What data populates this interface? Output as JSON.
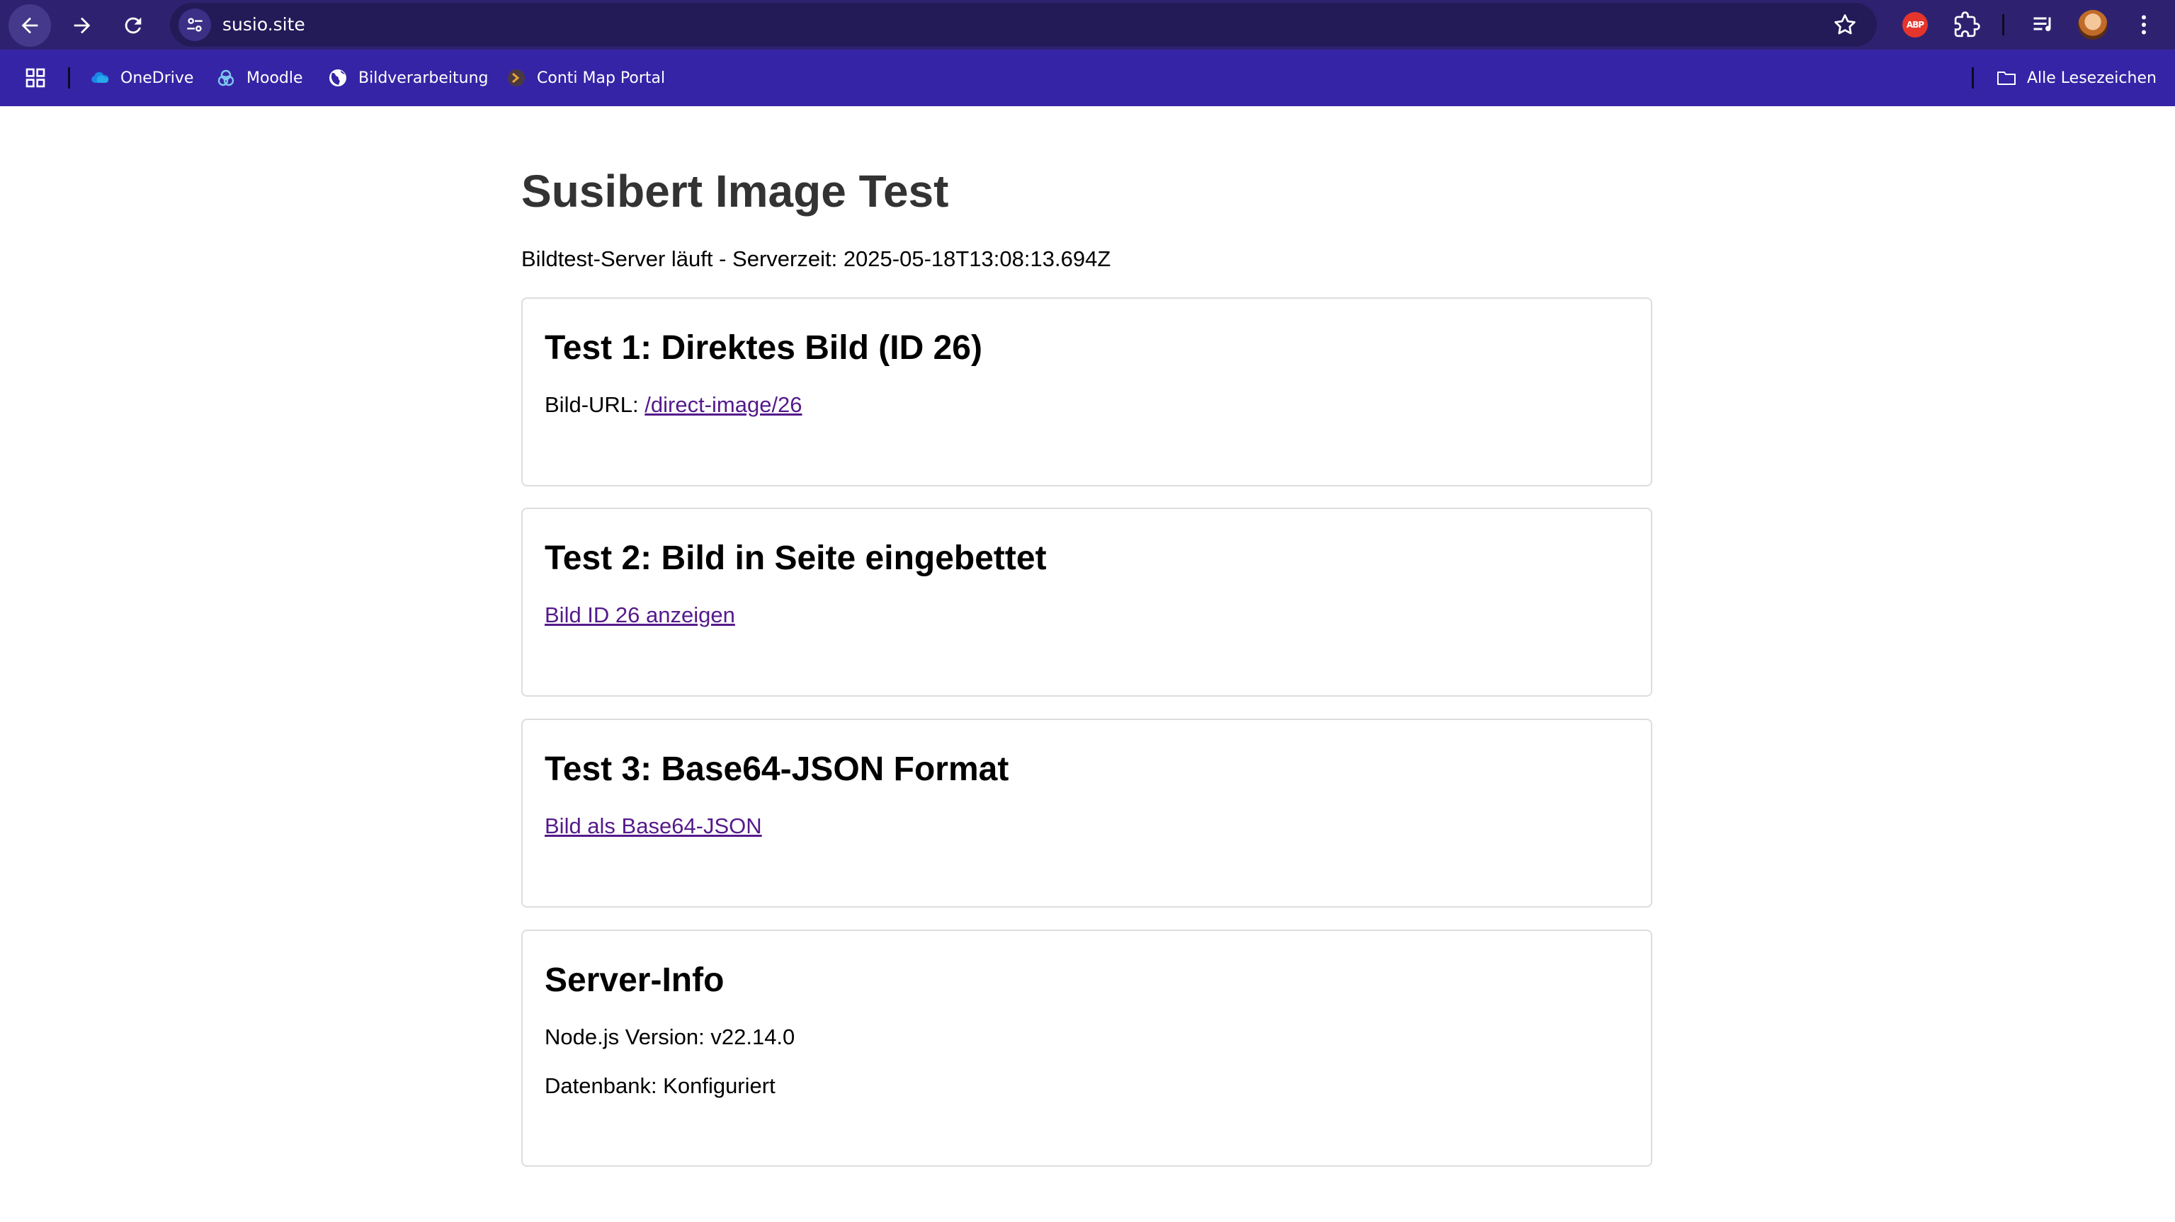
{
  "browser": {
    "url": "susio.site",
    "abp_label": "ABP",
    "bookmarks": [
      {
        "label": "OneDrive",
        "icon": "onedrive-icon"
      },
      {
        "label": "Moodle",
        "icon": "moodle-icon"
      },
      {
        "label": "Bildverarbeitung",
        "icon": "globe-icon"
      },
      {
        "label": "Conti Map Portal",
        "icon": "map-portal-icon"
      }
    ],
    "all_bookmarks": "Alle Lesezeichen",
    "colors": {
      "toolbar": "#2e2270",
      "bookmark_bar": "#3624a6",
      "omnibox": "#231a58"
    }
  },
  "page": {
    "title": "Susibert Image Test",
    "status": "Bildtest-Server läuft - Serverzeit: 2025-05-18T13:08:13.694Z",
    "test1": {
      "heading": "Test 1: Direktes Bild (ID 26)",
      "url_label": "Bild-URL: ",
      "url_link": "/direct-image/26"
    },
    "test2": {
      "heading": "Test 2: Bild in Seite eingebettet",
      "link": "Bild ID 26 anzeigen"
    },
    "test3": {
      "heading": "Test 3: Base64-JSON Format",
      "link": "Bild als Base64-JSON"
    },
    "server_info": {
      "heading": "Server-Info",
      "node_label": "Node.js Version: ",
      "node_value": "v22.14.0",
      "db_label": "Datenbank: ",
      "db_value": "Konfiguriert"
    },
    "colors": {
      "title": "#333333",
      "link": "#551a8b",
      "card_border": "#dddddd"
    }
  }
}
